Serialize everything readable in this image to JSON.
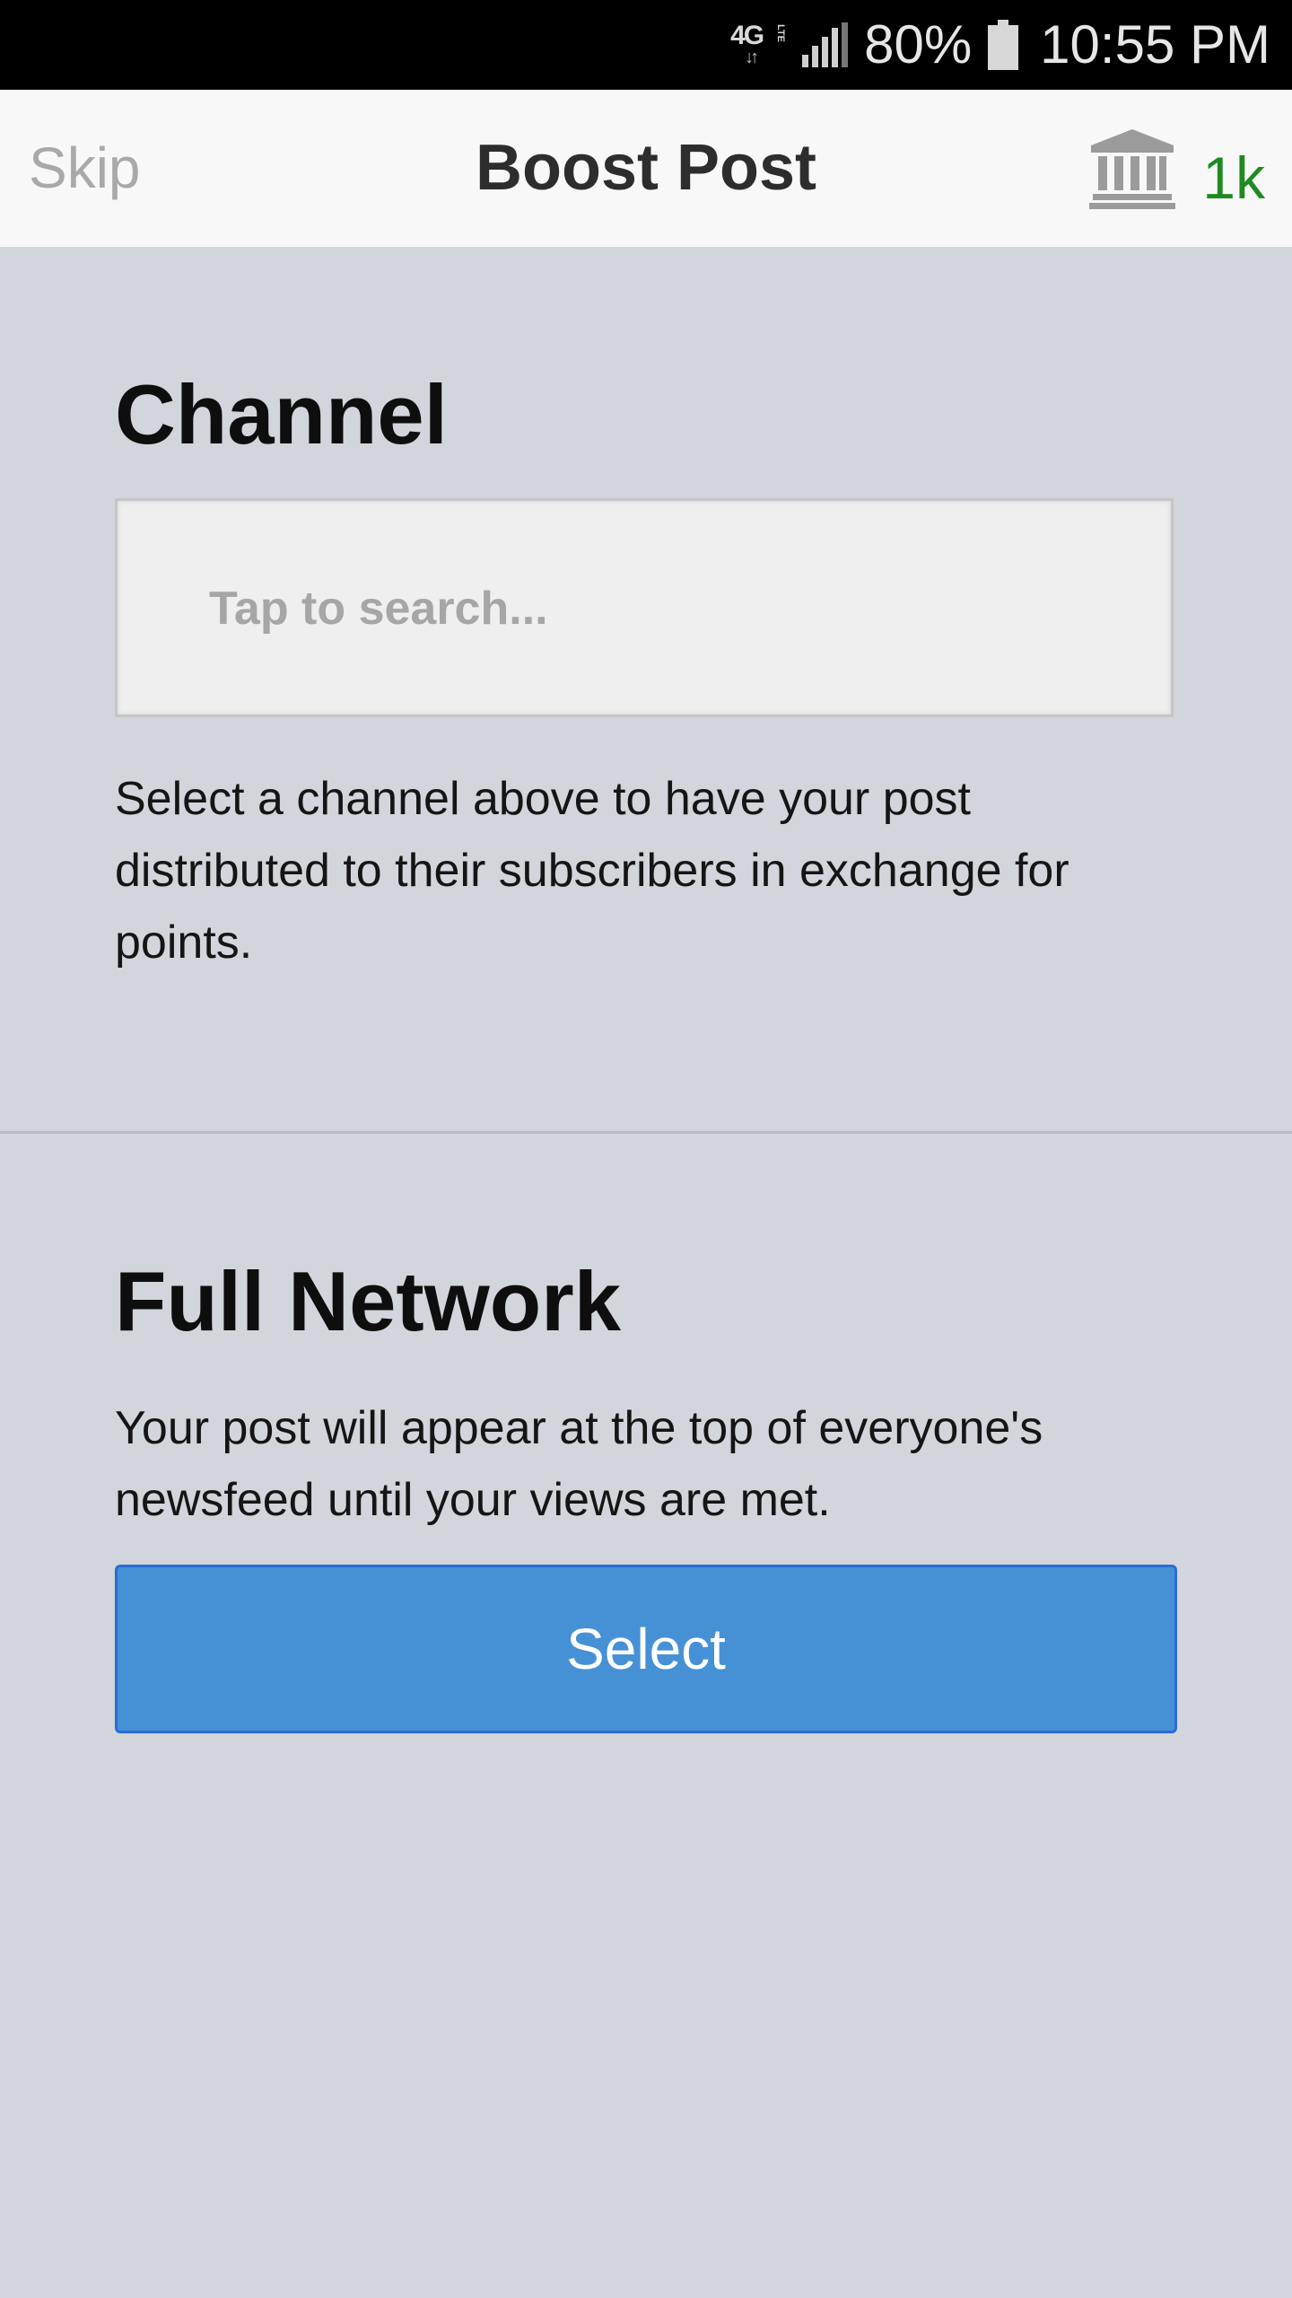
{
  "status_bar": {
    "network": "4G",
    "network_sub": "LTE",
    "battery_percent": "80%",
    "time": "10:55 PM",
    "icons": [
      "4g-lte-icon",
      "signal-icon",
      "battery-icon"
    ]
  },
  "header": {
    "skip_label": "Skip",
    "title": "Boost Post",
    "points_icon": "bank-icon",
    "points_value": "1k",
    "points_color": "#1f8a1f"
  },
  "channel": {
    "heading": "Channel",
    "search_placeholder": "Tap to search...",
    "description": "Select a channel above to have your post distributed to their subscribers in exchange for points."
  },
  "network": {
    "heading": "Full Network",
    "description": "Your post will appear at the top of everyone's newsfeed until your views are met.",
    "button_label": "Select",
    "button_color": "#4691d6"
  }
}
